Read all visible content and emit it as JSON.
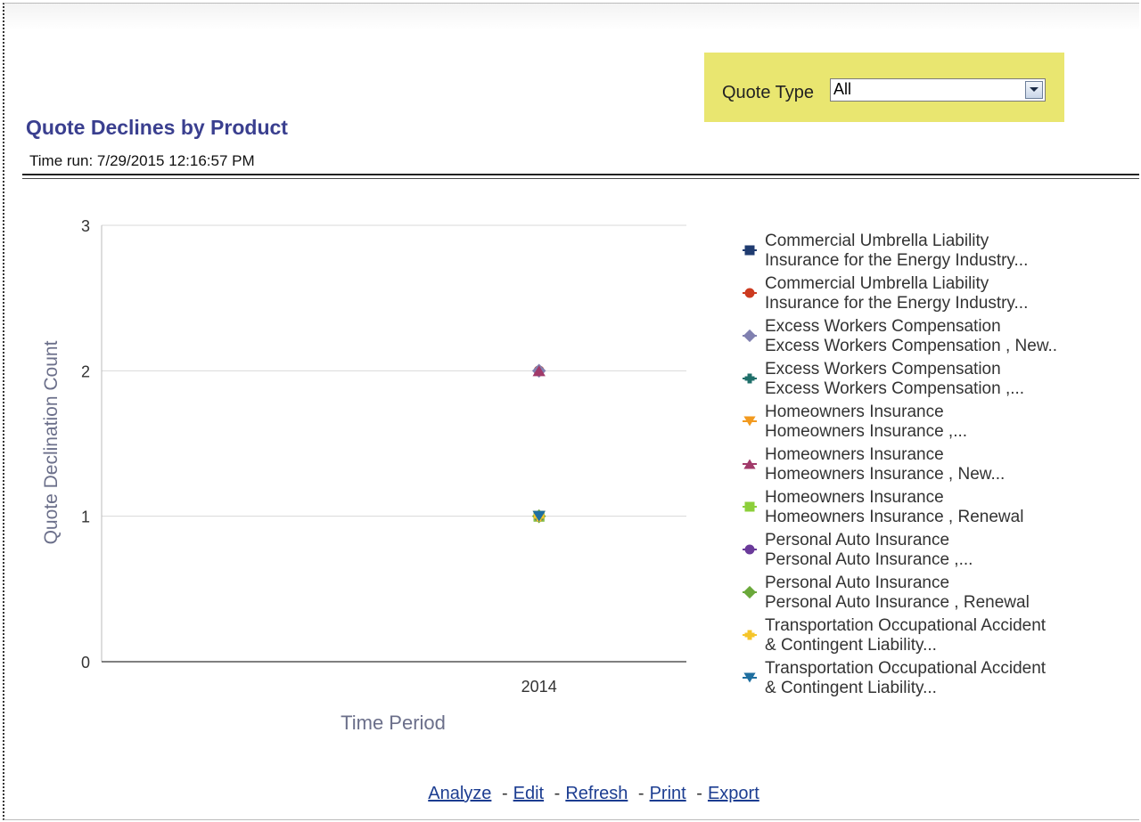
{
  "filter": {
    "label": "Quote Type",
    "selected": "All"
  },
  "header": {
    "title": "Quote Declines by Product",
    "time_run": "Time run: 7/29/2015 12:16:57 PM"
  },
  "chart_data": {
    "type": "scatter",
    "title": "",
    "xlabel": "Time Period",
    "ylabel": "Quote Declination Count",
    "categories": [
      "2014"
    ],
    "ylim": [
      0,
      3
    ],
    "yticks": [
      "0",
      "1",
      "2",
      "3"
    ],
    "grid": true,
    "legend_position": "right",
    "series": [
      {
        "name": "Commercial Umbrella Liability\nInsurance for the Energy Industry...",
        "values": [
          1
        ],
        "color": "#1f3b70",
        "marker": "square"
      },
      {
        "name": "Commercial Umbrella Liability\nInsurance for the Energy Industry...",
        "values": [
          2
        ],
        "color": "#cc3a1f",
        "marker": "circle"
      },
      {
        "name": "Excess Workers Compensation\nExcess Workers Compensation , New..",
        "values": [
          2
        ],
        "color": "#8080b0",
        "marker": "diamond"
      },
      {
        "name": "Excess Workers Compensation\nExcess Workers Compensation ,...",
        "values": [
          1
        ],
        "color": "#1f6f6a",
        "marker": "plus"
      },
      {
        "name": "Homeowners Insurance\nHomeowners Insurance ,...",
        "values": [
          1
        ],
        "color": "#f29a1f",
        "marker": "triangle-down"
      },
      {
        "name": "Homeowners Insurance\nHomeowners Insurance , New...",
        "values": [
          2
        ],
        "color": "#a13a6a",
        "marker": "triangle-up"
      },
      {
        "name": "Homeowners Insurance\nHomeowners Insurance , Renewal",
        "values": [
          1
        ],
        "color": "#8ccf3a",
        "marker": "square"
      },
      {
        "name": "Personal Auto Insurance\nPersonal Auto Insurance ,...",
        "values": [
          1
        ],
        "color": "#6a3a9a",
        "marker": "circle"
      },
      {
        "name": "Personal Auto Insurance\nPersonal Auto Insurance , Renewal",
        "values": [
          1
        ],
        "color": "#6aa83a",
        "marker": "diamond"
      },
      {
        "name": "Transportation Occupational Accident\n& Contingent Liability...",
        "values": [
          1
        ],
        "color": "#f5c52a",
        "marker": "plus"
      },
      {
        "name": "Transportation Occupational Accident\n& Contingent Liability...",
        "values": [
          1
        ],
        "color": "#1f6fa0",
        "marker": "triangle-down"
      }
    ]
  },
  "links": {
    "analyze": "Analyze",
    "edit": "Edit",
    "refresh": "Refresh",
    "print": "Print",
    "export": "Export",
    "separator": "-"
  },
  "icons": {
    "dropdown": "chevron-down-icon"
  }
}
